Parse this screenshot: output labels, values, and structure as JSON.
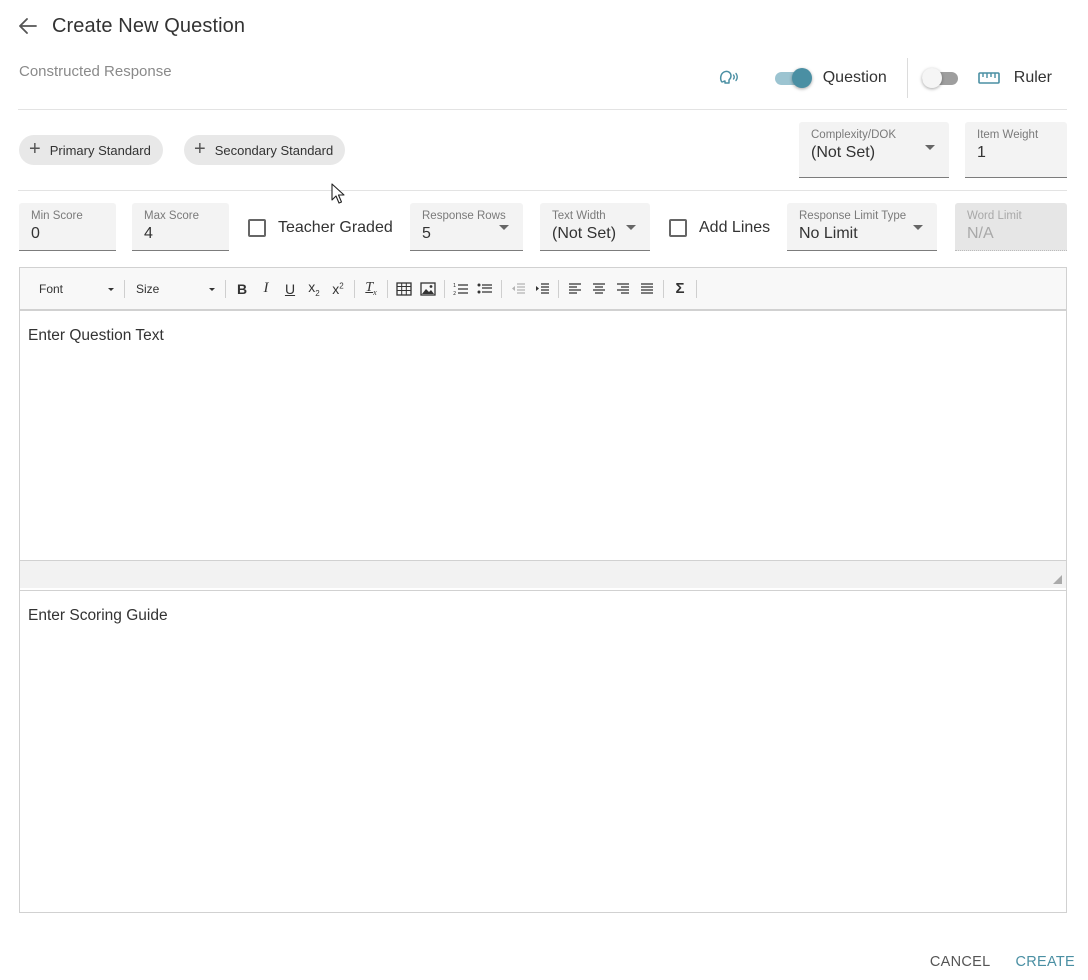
{
  "header": {
    "title": "Create New Question"
  },
  "subtitle": "Constructed Response",
  "tools": {
    "question_toggle_label": "Question",
    "question_toggle_on": true,
    "ruler_toggle_label": "Ruler",
    "ruler_toggle_on": false,
    "accent_color": "#4a8fa3"
  },
  "standards": {
    "primary_label": "Primary Standard",
    "secondary_label": "Secondary Standard"
  },
  "complexity": {
    "label": "Complexity/DOK",
    "value": "(Not Set)"
  },
  "item_weight": {
    "label": "Item Weight",
    "value": "1"
  },
  "settings": {
    "min_score": {
      "label": "Min Score",
      "value": "0"
    },
    "max_score": {
      "label": "Max Score",
      "value": "4"
    },
    "teacher_graded": {
      "label": "Teacher Graded",
      "checked": false
    },
    "response_rows": {
      "label": "Response Rows",
      "value": "5"
    },
    "text_width": {
      "label": "Text Width",
      "value": "(Not Set)"
    },
    "add_lines": {
      "label": "Add Lines",
      "checked": false
    },
    "response_limit_type": {
      "label": "Response Limit Type",
      "value": "No Limit"
    },
    "word_limit": {
      "label": "Word Limit",
      "value": "N/A"
    }
  },
  "editor": {
    "font_label": "Font",
    "size_label": "Size",
    "question_placeholder": "Enter Question Text"
  },
  "scoring_guide_placeholder": "Enter Scoring Guide",
  "actions": {
    "cancel": "CANCEL",
    "create": "CREATE"
  }
}
